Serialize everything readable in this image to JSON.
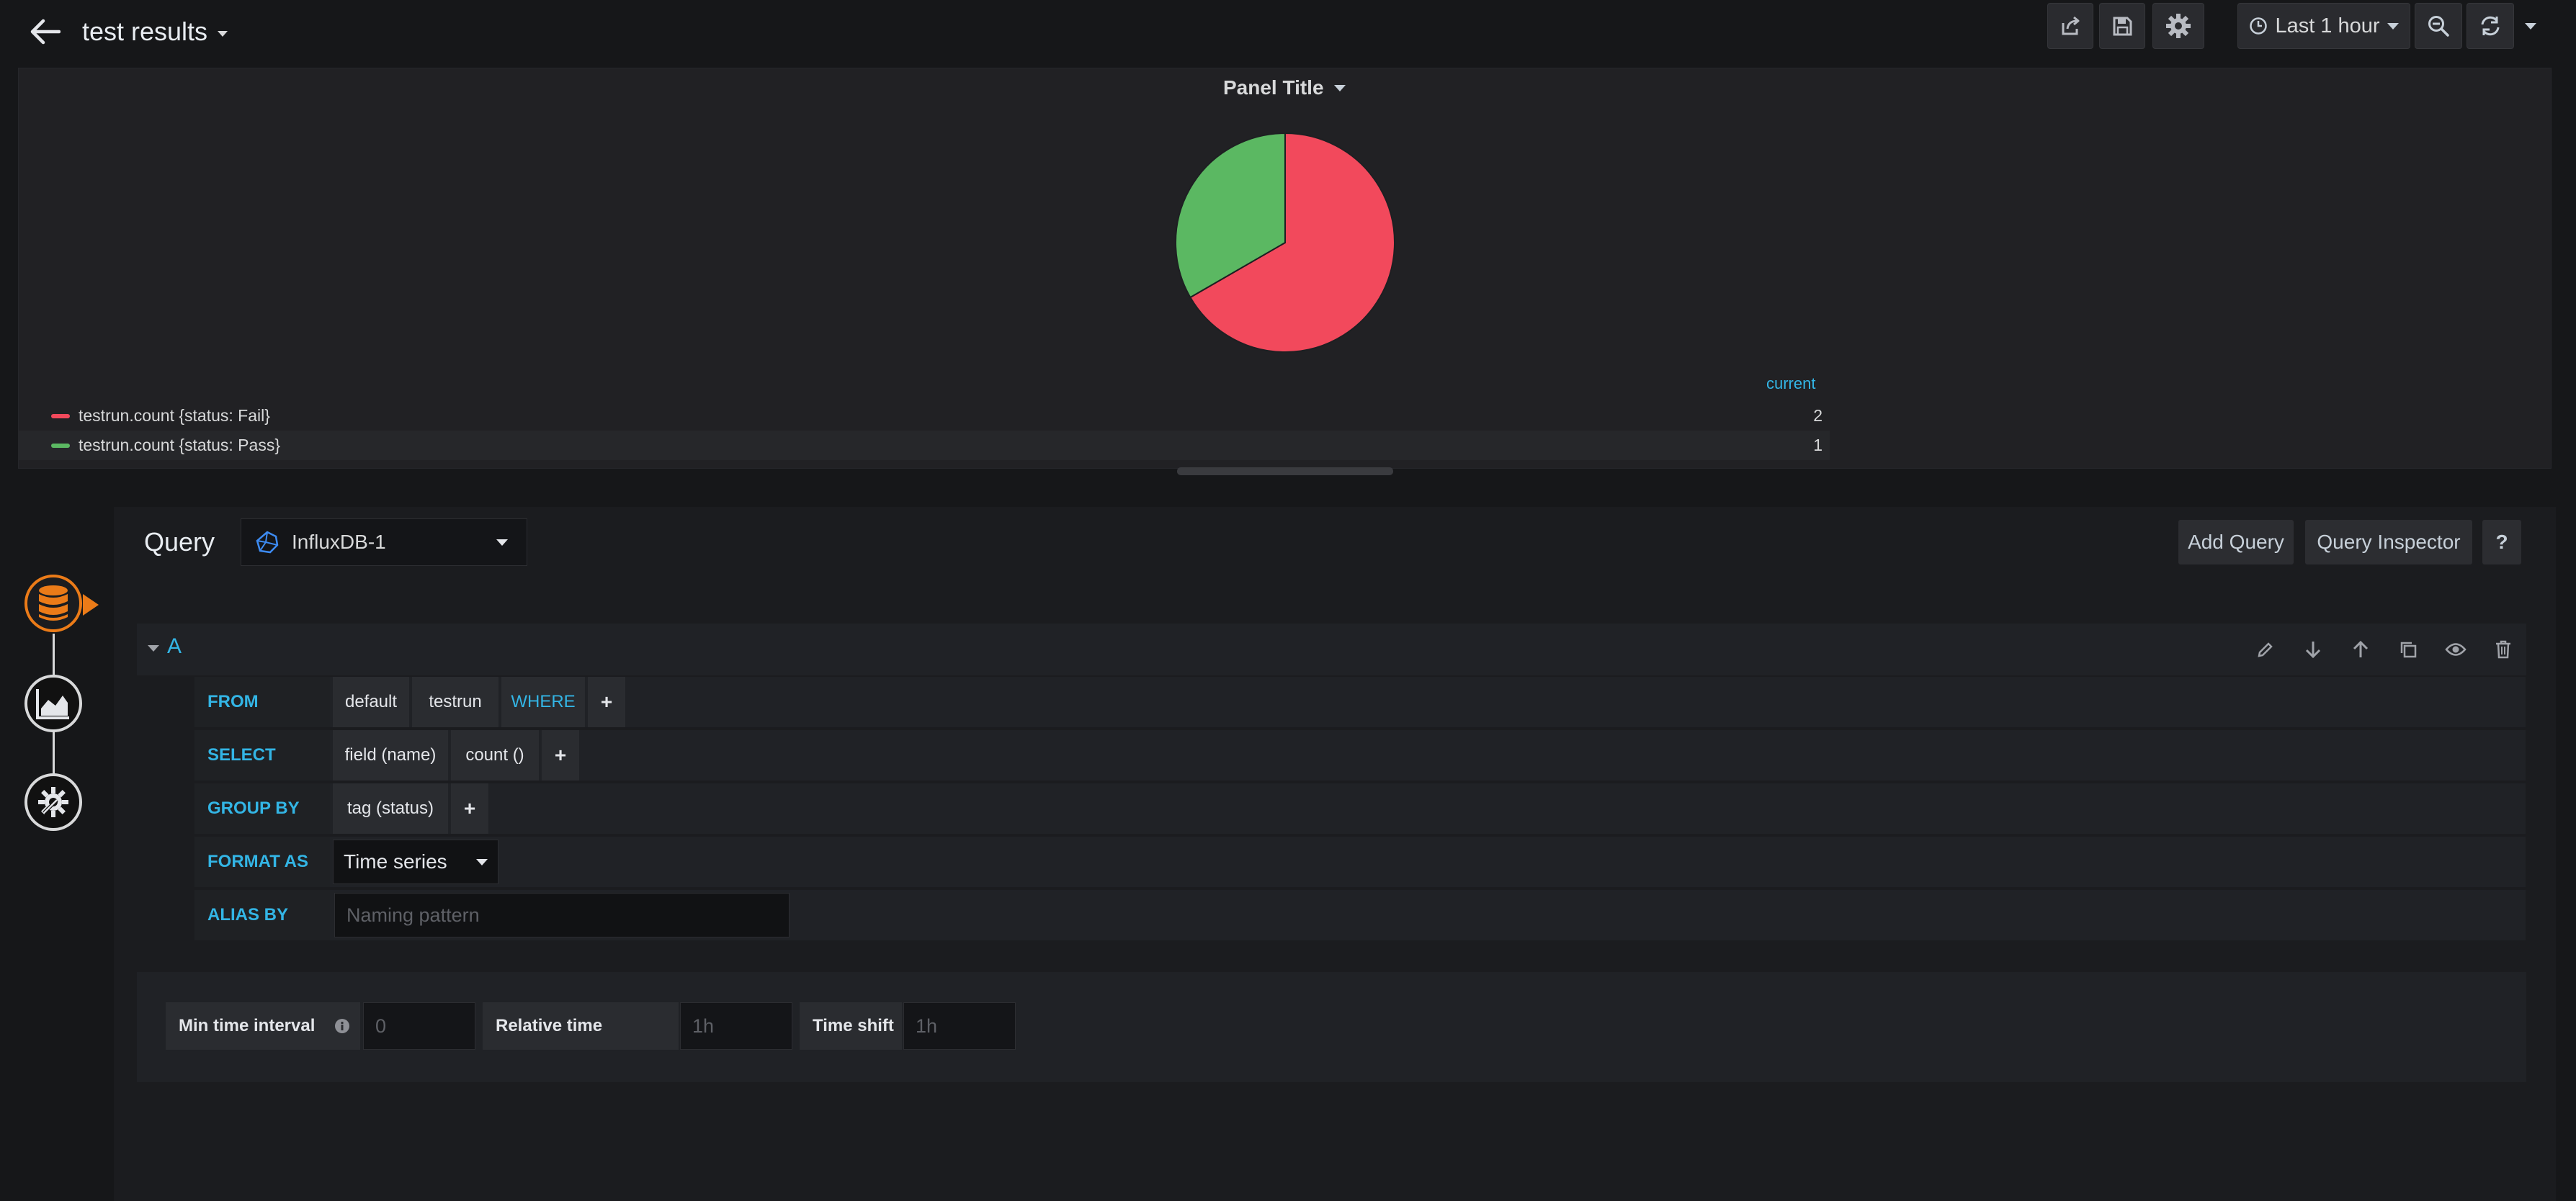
{
  "header": {
    "title": "test results",
    "time_range": "Last 1 hour",
    "icons": [
      "back-arrow-icon",
      "share-icon",
      "save-icon",
      "settings-gear-icon",
      "clock-icon",
      "zoom-out-icon",
      "refresh-icon",
      "chevron-down-icon"
    ]
  },
  "panel": {
    "title": "Panel Title",
    "legend_header": "current",
    "legend": [
      {
        "label": "testrun.count {status: Fail}",
        "value": "2",
        "color": "#f2495c"
      },
      {
        "label": "testrun.count {status: Pass}",
        "value": "1",
        "color": "#5bb862"
      }
    ]
  },
  "chart_data": {
    "type": "pie",
    "categories": [
      "testrun.count {status: Fail}",
      "testrun.count {status: Pass}"
    ],
    "values": [
      2,
      1
    ],
    "colors": [
      "#f2495c",
      "#5bb862"
    ],
    "title": "Panel Title"
  },
  "query": {
    "label": "Query",
    "datasource": "InfluxDB-1",
    "add_query_label": "Add Query",
    "inspector_label": "Query Inspector",
    "help_label": "?",
    "row_letter": "A",
    "from_kw": "FROM",
    "from_policy": "default",
    "from_measurement": "testrun",
    "where_kw": "WHERE",
    "select_kw": "SELECT",
    "select_field": "field (name)",
    "select_fn": "count ()",
    "group_kw": "GROUP BY",
    "group_tag": "tag (status)",
    "format_kw": "FORMAT AS",
    "format_value": "Time series",
    "alias_kw": "ALIAS BY",
    "alias_placeholder": "Naming pattern",
    "plus": "+"
  },
  "options": {
    "min_interval_label": "Min time interval",
    "min_interval_placeholder": "0",
    "relative_label": "Relative time",
    "relative_placeholder": "1h",
    "shift_label": "Time shift",
    "shift_placeholder": "1h"
  },
  "colors": {
    "accent": "#33b5e5",
    "active_step": "#eb7b18",
    "background": "#161719"
  }
}
